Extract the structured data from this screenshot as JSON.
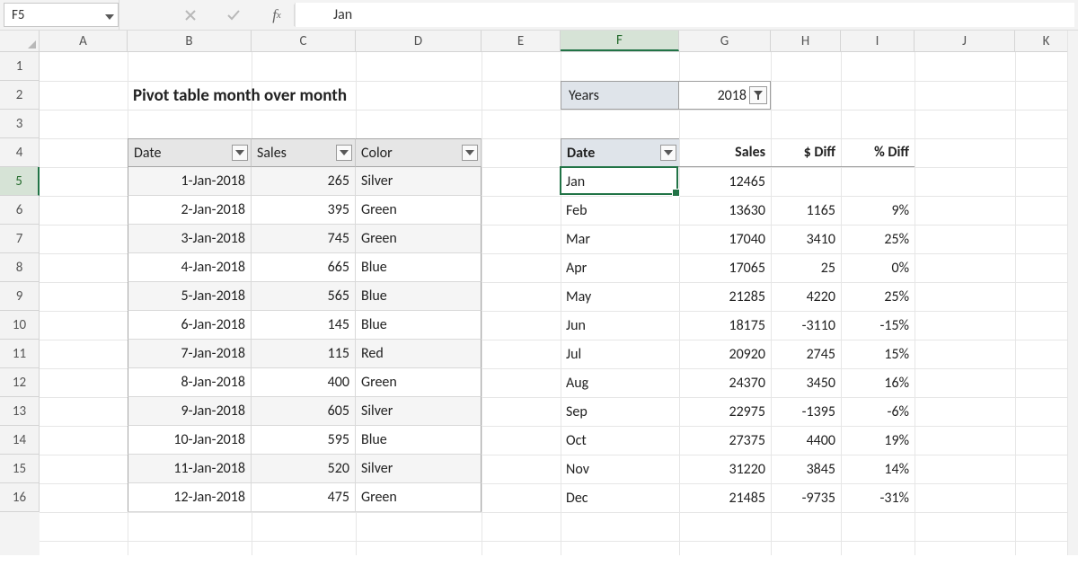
{
  "formula_bar": {
    "name_box": "F5",
    "formula_text": "Jan"
  },
  "columns": {
    "letters": [
      "A",
      "B",
      "C",
      "D",
      "E",
      "F",
      "G",
      "H",
      "I",
      "J",
      "K"
    ],
    "widths": [
      98,
      138,
      116,
      140,
      88,
      132,
      102,
      78,
      82,
      112,
      70
    ],
    "selected": "F"
  },
  "row_count": 16,
  "selected_row": 5,
  "title": "Pivot table month over month",
  "table": {
    "headers": [
      "Date",
      "Sales",
      "Color"
    ],
    "rows": [
      {
        "date": "1-Jan-2018",
        "sales": "265",
        "color": "Silver"
      },
      {
        "date": "2-Jan-2018",
        "sales": "395",
        "color": "Green"
      },
      {
        "date": "3-Jan-2018",
        "sales": "745",
        "color": "Green"
      },
      {
        "date": "4-Jan-2018",
        "sales": "665",
        "color": "Blue"
      },
      {
        "date": "5-Jan-2018",
        "sales": "565",
        "color": "Blue"
      },
      {
        "date": "6-Jan-2018",
        "sales": "145",
        "color": "Blue"
      },
      {
        "date": "7-Jan-2018",
        "sales": "115",
        "color": "Red"
      },
      {
        "date": "8-Jan-2018",
        "sales": "400",
        "color": "Green"
      },
      {
        "date": "9-Jan-2018",
        "sales": "605",
        "color": "Silver"
      },
      {
        "date": "10-Jan-2018",
        "sales": "595",
        "color": "Blue"
      },
      {
        "date": "11-Jan-2018",
        "sales": "520",
        "color": "Silver"
      },
      {
        "date": "12-Jan-2018",
        "sales": "475",
        "color": "Green"
      }
    ]
  },
  "pivot_filter": {
    "label": "Years",
    "value": "2018"
  },
  "pivot": {
    "headers": [
      "Date",
      "Sales",
      "$ Diff",
      "% Diff"
    ],
    "rows": [
      {
        "m": "Jan",
        "sales": "12465",
        "diff": "",
        "pct": ""
      },
      {
        "m": "Feb",
        "sales": "13630",
        "diff": "1165",
        "pct": "9%"
      },
      {
        "m": "Mar",
        "sales": "17040",
        "diff": "3410",
        "pct": "25%"
      },
      {
        "m": "Apr",
        "sales": "17065",
        "diff": "25",
        "pct": "0%"
      },
      {
        "m": "May",
        "sales": "21285",
        "diff": "4220",
        "pct": "25%"
      },
      {
        "m": "Jun",
        "sales": "18175",
        "diff": "-3110",
        "pct": "-15%"
      },
      {
        "m": "Jul",
        "sales": "20920",
        "diff": "2745",
        "pct": "15%"
      },
      {
        "m": "Aug",
        "sales": "24370",
        "diff": "3450",
        "pct": "16%"
      },
      {
        "m": "Sep",
        "sales": "22975",
        "diff": "-1395",
        "pct": "-6%"
      },
      {
        "m": "Oct",
        "sales": "27375",
        "diff": "4400",
        "pct": "19%"
      },
      {
        "m": "Nov",
        "sales": "31220",
        "diff": "3845",
        "pct": "14%"
      },
      {
        "m": "Dec",
        "sales": "21485",
        "diff": "-9735",
        "pct": "-31%"
      }
    ]
  },
  "active_cell": {
    "col": "F",
    "row": 5
  }
}
